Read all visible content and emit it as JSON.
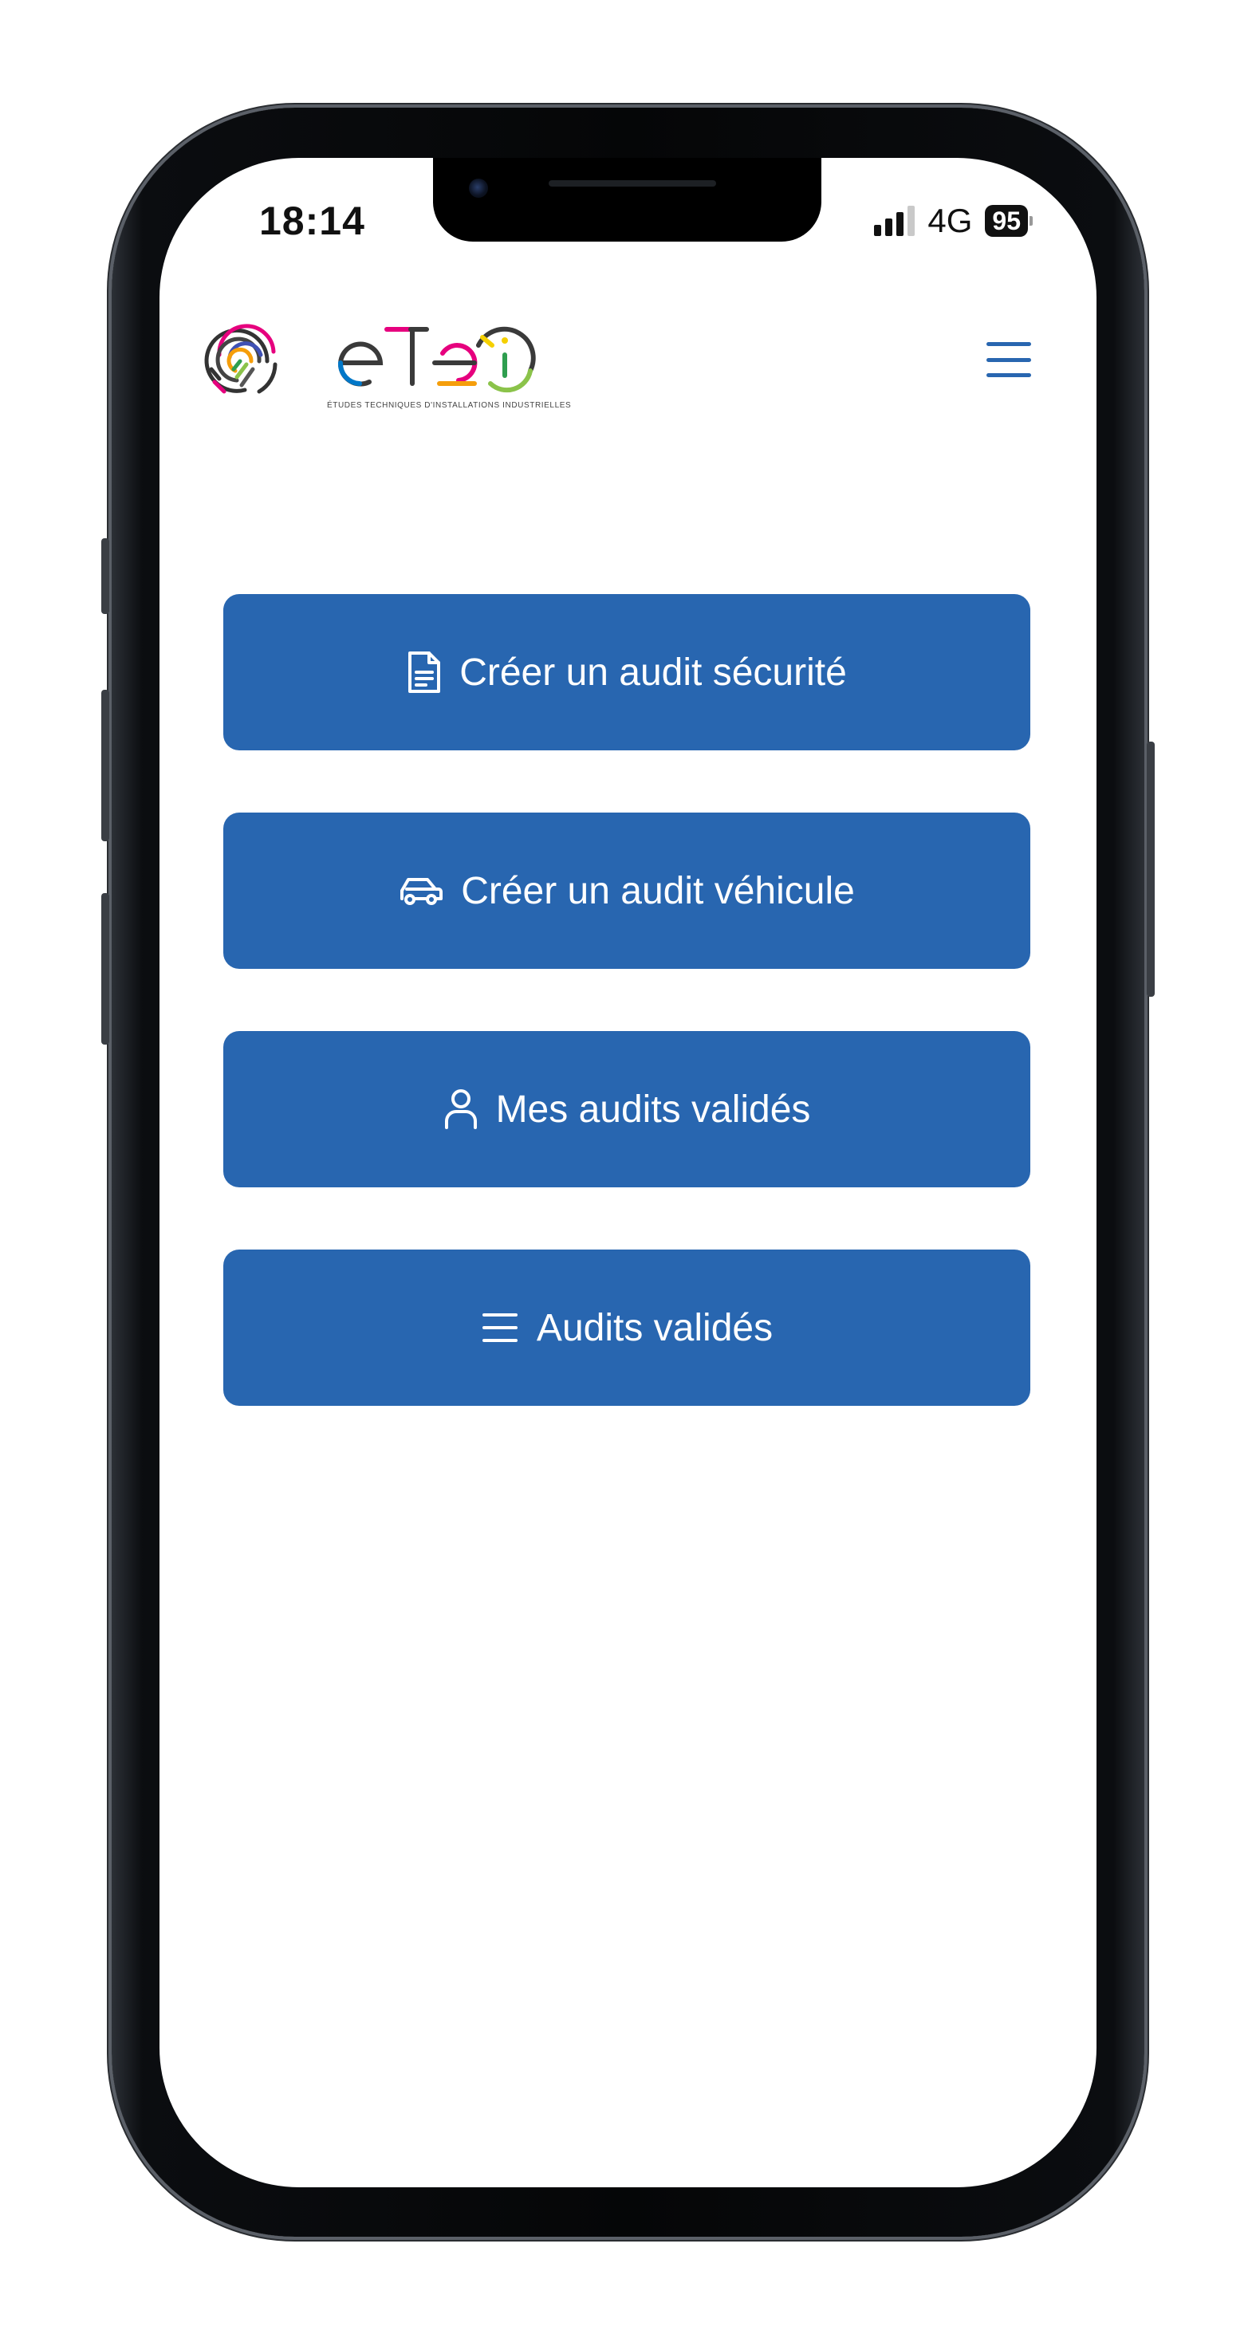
{
  "status_bar": {
    "time": "18:14",
    "network": "4G",
    "battery": "95"
  },
  "header": {
    "logo_text": "etei",
    "logo_caption": "ÉTUDES TECHNIQUES D'INSTALLATIONS INDUSTRIELLES",
    "menu_icon": "hamburger-menu-icon"
  },
  "actions": [
    {
      "label": "Créer un audit sécurité",
      "icon": "document-icon"
    },
    {
      "label": "Créer un audit véhicule",
      "icon": "car-icon"
    },
    {
      "label": "Mes audits validés",
      "icon": "user-icon"
    },
    {
      "label": "Audits validés",
      "icon": "list-icon"
    }
  ],
  "colors": {
    "primary": "#2866b0",
    "background": "#ffffff",
    "logo_text": "#3a3a3a"
  }
}
